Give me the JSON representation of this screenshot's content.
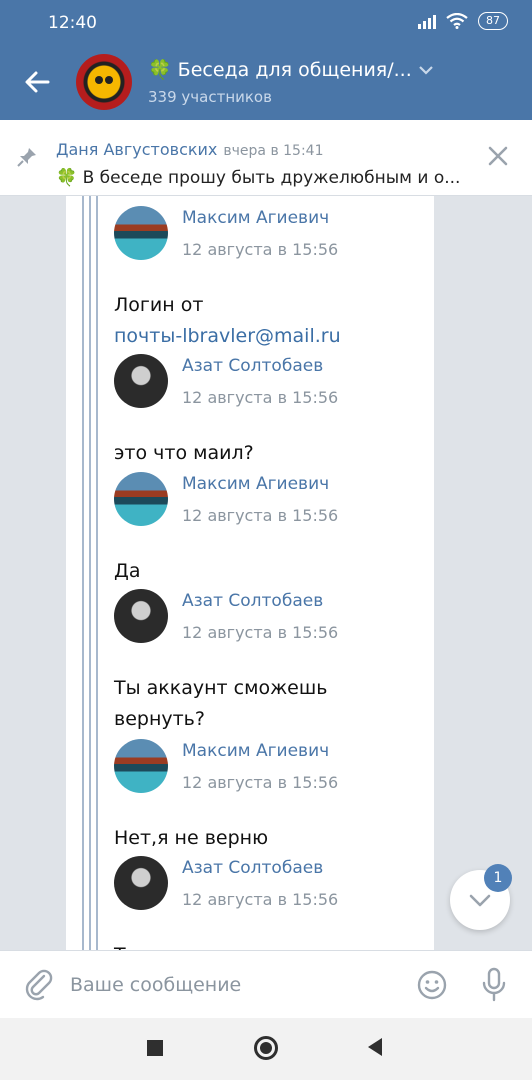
{
  "status": {
    "time": "12:40",
    "battery": "87"
  },
  "header": {
    "clover": "🍀",
    "title": "Беседа для общения/...",
    "subtitle": "339 участников"
  },
  "pinned": {
    "author": "Даня Августовских",
    "time": "вчера в 15:41",
    "text": "🍀 В беседе прошу быть дружелюбным и о..."
  },
  "messages": [
    {
      "author": "Максим Агиевич",
      "time": "12 августа в 15:56",
      "text": "Логин от",
      "link": "почты-lbravler@mail.ru",
      "avatar": "mountain-lake"
    },
    {
      "author": "Азат Солтобаев",
      "time": "12 августа в 15:56",
      "text": "это что маил?",
      "avatar": "person"
    },
    {
      "author": "Максим Агиевич",
      "time": "12 августа в 15:56",
      "text": "Да",
      "avatar": "mountain-lake"
    },
    {
      "author": "Азат Солтобаев",
      "time": "12 августа в 15:56",
      "text": "Ты аккаунт сможешь вернуть?",
      "avatar": "person"
    },
    {
      "author": "Максим Агиевич",
      "time": "12 августа в 15:56",
      "text": "Нет,я не верню",
      "avatar": "mountain-lake"
    },
    {
      "author": "Азат Солтобаев",
      "time": "12 августа в 15:56",
      "text": "Ты помнишь от него там гол",
      "avatar": "person"
    }
  ],
  "scroll_button": {
    "badge": "1"
  },
  "composer": {
    "placeholder": "Ваше сообщение"
  },
  "colors": {
    "brand": "#4a76a8",
    "link": "#3b6ea5",
    "badge": "#5181b8"
  },
  "icons": [
    "back-arrow-icon",
    "pin-icon",
    "close-icon",
    "chevron-down-icon",
    "attach-icon",
    "emoji-icon",
    "mic-icon"
  ]
}
